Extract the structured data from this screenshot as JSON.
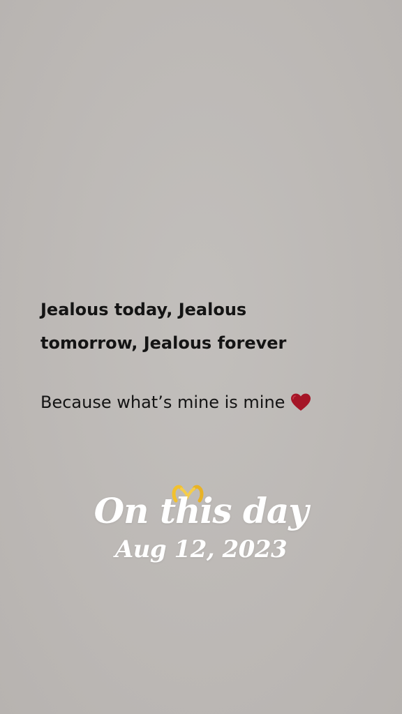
{
  "quote": {
    "line1": "Jealous today, Jealous",
    "line2": "tomorrow, Jealous forever",
    "subline": "Because what’s mine is mine",
    "heart_icon": "red-heart-icon",
    "heart_color": "#a51527"
  },
  "memory": {
    "title": "On this day",
    "date": "Aug 12, 2023",
    "sticker_icon": "heart-hands-icon",
    "sticker_color": "#f2c12e"
  },
  "colors": {
    "background": "#bdb9b6",
    "quote_text": "#141414",
    "memory_text": "#ffffff"
  }
}
